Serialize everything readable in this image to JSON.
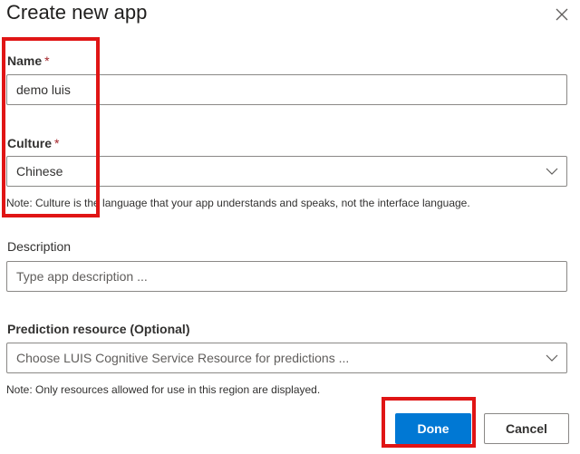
{
  "dialog": {
    "title": "Create new app",
    "close_icon": "close-icon"
  },
  "form": {
    "name": {
      "label": "Name",
      "required_mark": "*",
      "value": "demo luis"
    },
    "culture": {
      "label": "Culture",
      "required_mark": "*",
      "value": "Chinese",
      "note": "Note: Culture is the language that your app understands and speaks, not the interface language."
    },
    "description": {
      "label": "Description",
      "placeholder": "Type app description ..."
    },
    "prediction_resource": {
      "label": "Prediction resource (Optional)",
      "placeholder": "Choose LUIS Cognitive Service Resource for predictions ...",
      "note": "Note: Only resources allowed for use in this region are displayed."
    }
  },
  "actions": {
    "done_label": "Done",
    "cancel_label": "Cancel"
  },
  "colors": {
    "primary": "#0078d4",
    "required": "#a4262c",
    "highlight": "#e01515"
  }
}
